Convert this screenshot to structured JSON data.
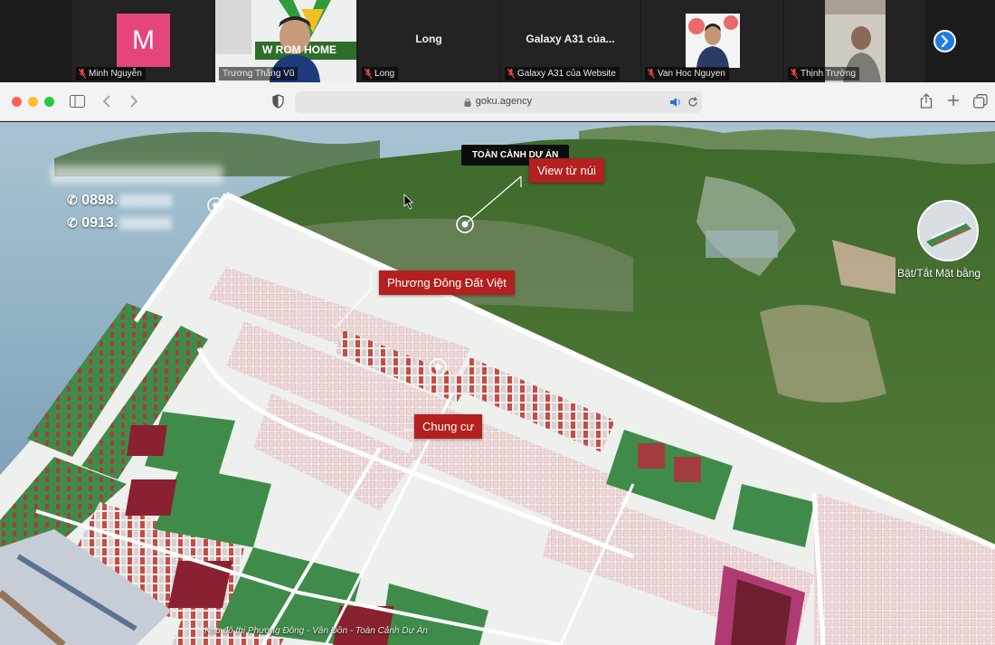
{
  "meeting": {
    "participants": [
      {
        "name": "Minh Nguyễn",
        "avatar_letter": "M",
        "avatar_color": "#e5457c",
        "muted": true
      },
      {
        "name": "Trương Thắng Vũ",
        "muted": false,
        "active": true,
        "banner_text": "W  ROM HOME"
      },
      {
        "name": "Long",
        "display": "Long",
        "muted": true
      },
      {
        "name": "Galaxy A31 của Website",
        "display": "Galaxy A31 của...",
        "muted": true
      },
      {
        "name": "Van Hoc Nguyen",
        "muted": true
      },
      {
        "name": "Thịnh Trường",
        "muted": true
      }
    ],
    "next_icon": "chevron-right-icon"
  },
  "browser": {
    "url": "goku.agency",
    "icons": [
      "sidebar-icon",
      "back-icon",
      "forward-icon",
      "shield-icon",
      "lock-icon",
      "speaker-icon",
      "reload-icon",
      "share-icon",
      "new-tab-icon",
      "tabs-icon"
    ]
  },
  "map": {
    "phones": [
      "0898.",
      "0913."
    ],
    "labels": {
      "overview": "TOÀN CẢNH DỰ ÁN",
      "mountain_view": "View từ núi",
      "phuong_dong": "Phương Đông Đất Việt",
      "apartment": "Chung cư"
    },
    "layer_toggle": "Bật/Tắt Mặt bằng",
    "bottom_caption": "Khu đô thị Phương Đông - Vân Đồn - Toàn Cảnh Dự Án",
    "accent_red": "#b3201f"
  }
}
